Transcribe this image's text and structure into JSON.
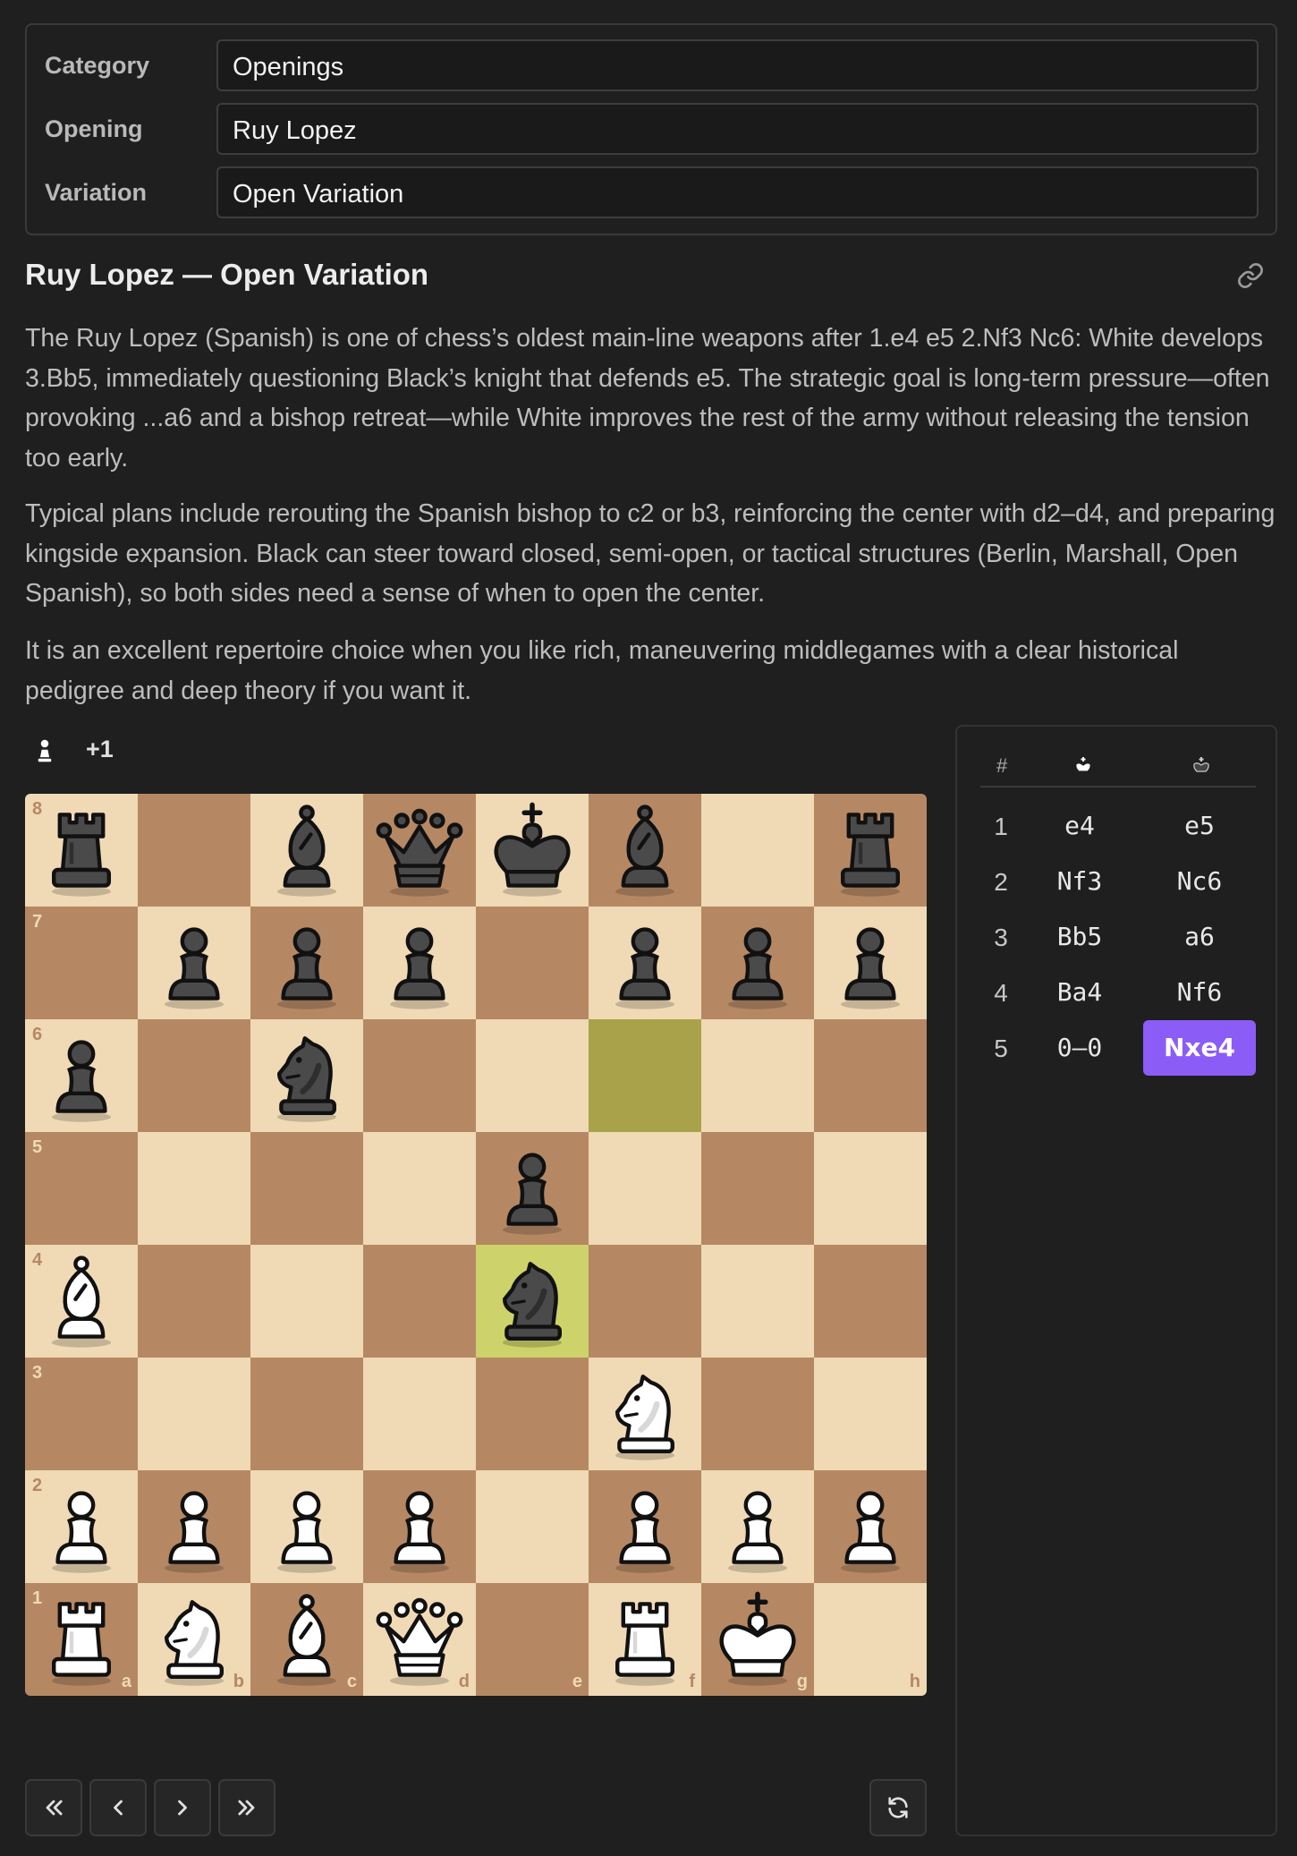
{
  "selectors": [
    {
      "label": "Category",
      "value": "Openings"
    },
    {
      "label": "Opening",
      "value": "Ruy Lopez"
    },
    {
      "label": "Variation",
      "value": "Open Variation"
    }
  ],
  "title": "Ruy Lopez — Open Variation",
  "description": [
    "The Ruy Lopez (Spanish) is one of chess’s oldest main-line weapons after 1.e4 e5 2.Nf3 Nc6: White develops 3.Bb5, immediately questioning Black’s knight that defends e5. The strategic goal is long-term pressure—often provoking ...a6 and a bishop retreat—while White improves the rest of the army without releasing the tension too early.",
    "Typical plans include rerouting the Spanish bishop to c2 or b3, reinforcing the center with d2–d4, and preparing kingside expansion. Black can steer toward closed, semi-open, or tactical structures (Berlin, Marshall, Open Spanish), so both sides need a sense of when to open the center.",
    "It is an excellent repertoire choice when you like rich, maneuvering middlegames with a clear historical pedigree and deep theory if you want it."
  ],
  "material": {
    "icon": "white-pawn-icon",
    "score": "+1"
  },
  "board": {
    "ranks": [
      "8",
      "7",
      "6",
      "5",
      "4",
      "3",
      "2",
      "1"
    ],
    "files": [
      "a",
      "b",
      "c",
      "d",
      "e",
      "f",
      "g",
      "h"
    ],
    "position": [
      [
        "r",
        "",
        "b",
        "q",
        "k",
        "b",
        "",
        "r"
      ],
      [
        "",
        "p",
        "p",
        "p",
        "",
        "p",
        "p",
        "p"
      ],
      [
        "p",
        "",
        "n",
        "",
        "",
        "",
        "",
        ""
      ],
      [
        "",
        "",
        "",
        "",
        "p",
        "",
        "",
        ""
      ],
      [
        "B",
        "",
        "",
        "",
        "n",
        "",
        "",
        ""
      ],
      [
        "",
        "",
        "",
        "",
        "",
        "N",
        "",
        ""
      ],
      [
        "P",
        "P",
        "P",
        "P",
        "",
        "P",
        "P",
        "P"
      ],
      [
        "R",
        "N",
        "B",
        "Q",
        "",
        "R",
        "K",
        ""
      ]
    ],
    "last_move_from": "f6",
    "last_move_to": "e4",
    "colors": {
      "light": "#f0d9b5",
      "dark": "#b58863",
      "highlight_from": "#aaa24a",
      "highlight_to": "#cdd26a"
    }
  },
  "moves": {
    "header": {
      "number": "#",
      "white_icon": "white-king-icon",
      "black_icon": "black-king-icon"
    },
    "rows": [
      {
        "num": "1",
        "white": "e4",
        "black": "e5"
      },
      {
        "num": "2",
        "white": "Nf3",
        "black": "Nc6"
      },
      {
        "num": "3",
        "white": "Bb5",
        "black": "a6"
      },
      {
        "num": "4",
        "white": "Ba4",
        "black": "Nf6"
      },
      {
        "num": "5",
        "white": "0–0",
        "black": "Nxe4"
      }
    ],
    "active": "Nxe4",
    "accent": "#8b5cf6"
  },
  "controls": [
    "first-move-icon",
    "previous-move-icon",
    "next-move-icon",
    "last-move-icon",
    "flip-board-icon"
  ]
}
